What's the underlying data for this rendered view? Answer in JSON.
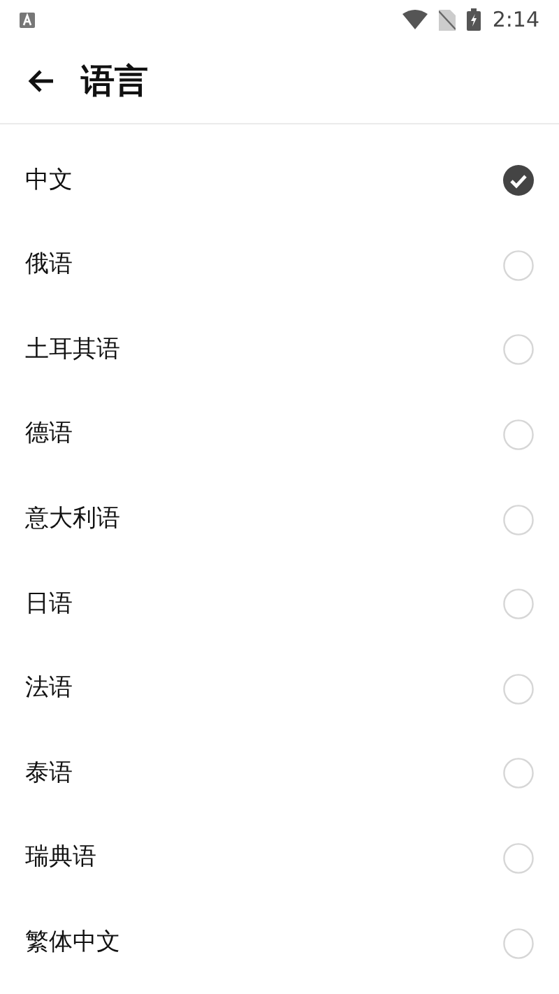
{
  "status_bar": {
    "time": "2:14"
  },
  "header": {
    "title": "语言"
  },
  "languages": [
    {
      "label": "中文",
      "selected": true
    },
    {
      "label": "俄语",
      "selected": false
    },
    {
      "label": "土耳其语",
      "selected": false
    },
    {
      "label": "德语",
      "selected": false
    },
    {
      "label": "意大利语",
      "selected": false
    },
    {
      "label": "日语",
      "selected": false
    },
    {
      "label": "法语",
      "selected": false
    },
    {
      "label": "泰语",
      "selected": false
    },
    {
      "label": "瑞典语",
      "selected": false
    },
    {
      "label": "繁体中文",
      "selected": false
    }
  ]
}
